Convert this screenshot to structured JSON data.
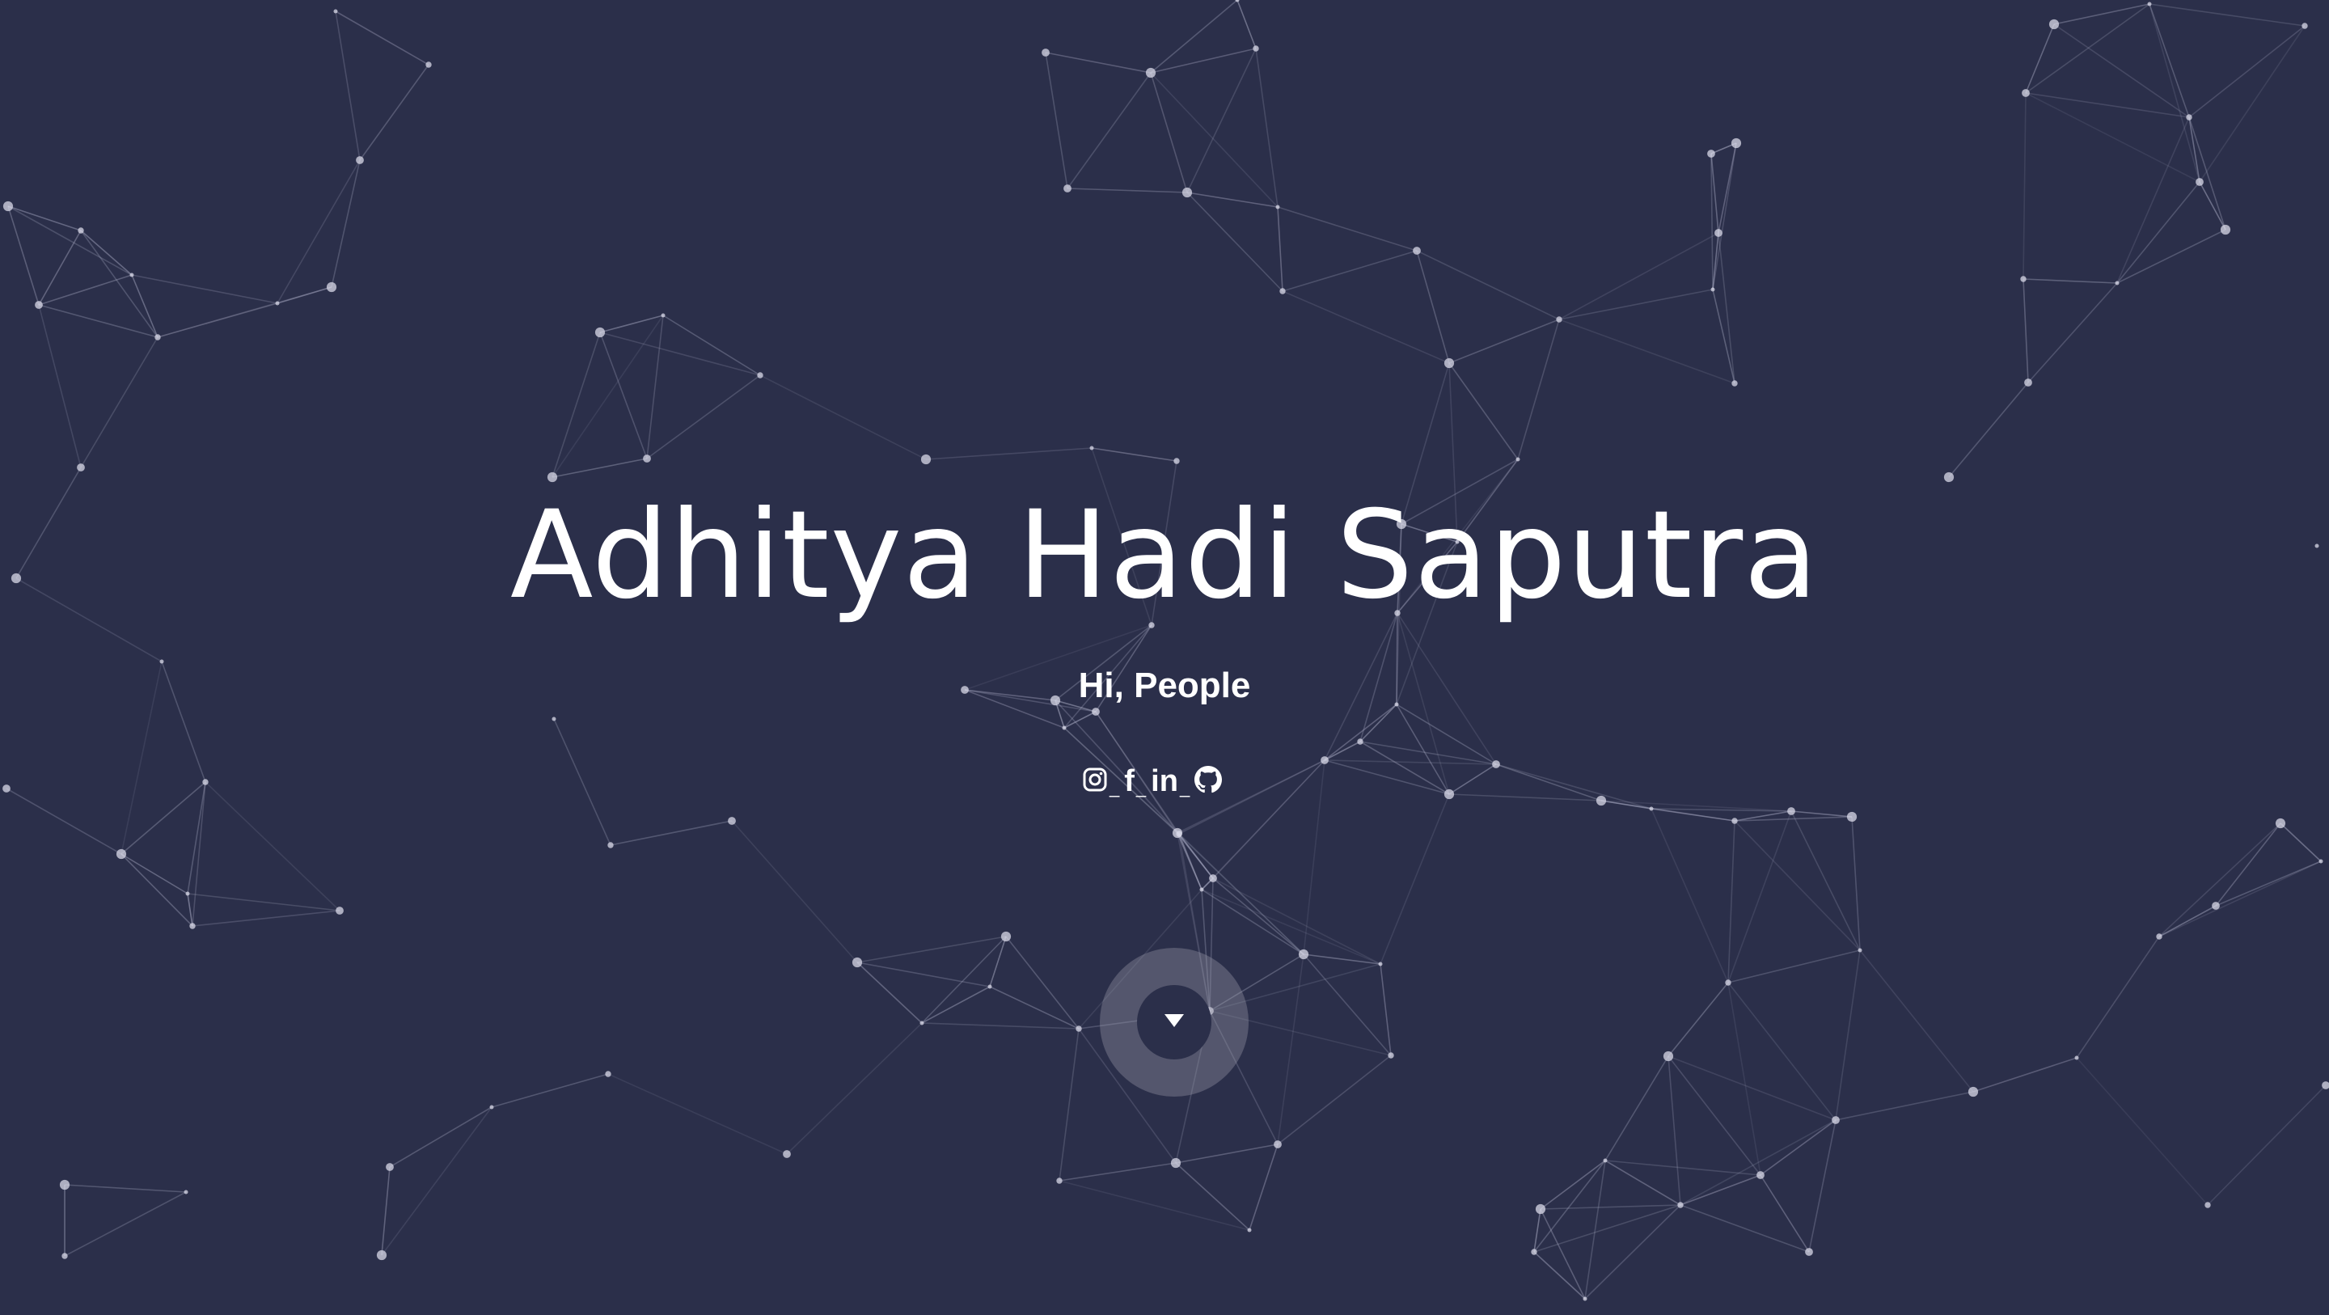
{
  "theme": {
    "background": "#2b2f4a",
    "network_line": "#aeb0c8",
    "text": "#ffffff"
  },
  "hero": {
    "title": "Adhitya Hadi Saputra",
    "subtitle": "Hi, People"
  },
  "social": {
    "items": [
      {
        "name": "instagram",
        "icon": "instagram-icon",
        "label": ""
      },
      {
        "name": "facebook",
        "icon": "facebook-icon",
        "label": "f"
      },
      {
        "name": "linkedin",
        "icon": "linkedin-icon",
        "label": "in"
      },
      {
        "name": "github",
        "icon": "github-icon",
        "label": ""
      }
    ],
    "separator": "_"
  },
  "scroll": {
    "icon": "caret-down-icon"
  }
}
